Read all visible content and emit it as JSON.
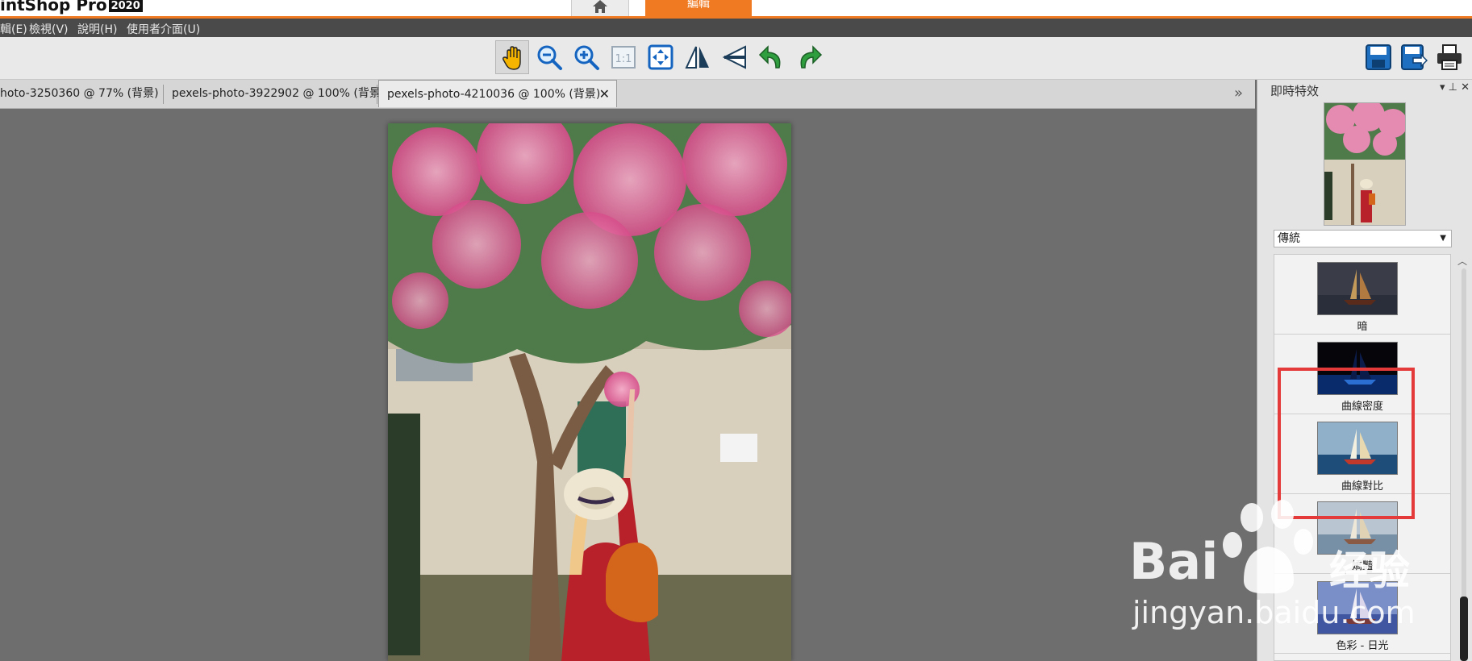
{
  "app": {
    "title": "intShop Pro",
    "year": "2020"
  },
  "top_tabs": {
    "edit_label": "編輯"
  },
  "menu": [
    {
      "label": "輯(E)"
    },
    {
      "label": "檢視(V)"
    },
    {
      "label": "說明(H)"
    },
    {
      "label": "使用者介面(U)"
    }
  ],
  "toolbar": {
    "tools": [
      "hand-icon",
      "zoom-out-icon",
      "zoom-in-icon",
      "actual-size-icon",
      "fit-window-icon",
      "flip-horizontal-icon",
      "flip-vertical-icon",
      "rotate-left-icon",
      "rotate-right-icon"
    ],
    "file_tools": [
      "save-icon",
      "save-as-icon",
      "print-icon"
    ]
  },
  "doc_tabs": [
    {
      "label": "hoto-3250360 @  77% (背景)"
    },
    {
      "label": "pexels-photo-3922902 @ 100% (背景)"
    },
    {
      "label": "pexels-photo-4210036 @ 100% (背景)"
    }
  ],
  "tab_close": "✕",
  "tabs_more": "»",
  "panel": {
    "title": "即時特效",
    "controls": "▾ ⊥ ✕",
    "category": "傳統",
    "effects": [
      {
        "label": "暗"
      },
      {
        "label": "曲線密度"
      },
      {
        "label": "曲線對比"
      },
      {
        "label": "嬌豔"
      },
      {
        "label": "色彩 - 日光"
      }
    ]
  },
  "watermark": {
    "brand": "Bai",
    "brand_cn": "经验",
    "url": "jingyan.baidu.com"
  },
  "colors": {
    "accent": "#f07a22",
    "highlight": "#e53a3a",
    "menubar": "#4a4a4a"
  }
}
